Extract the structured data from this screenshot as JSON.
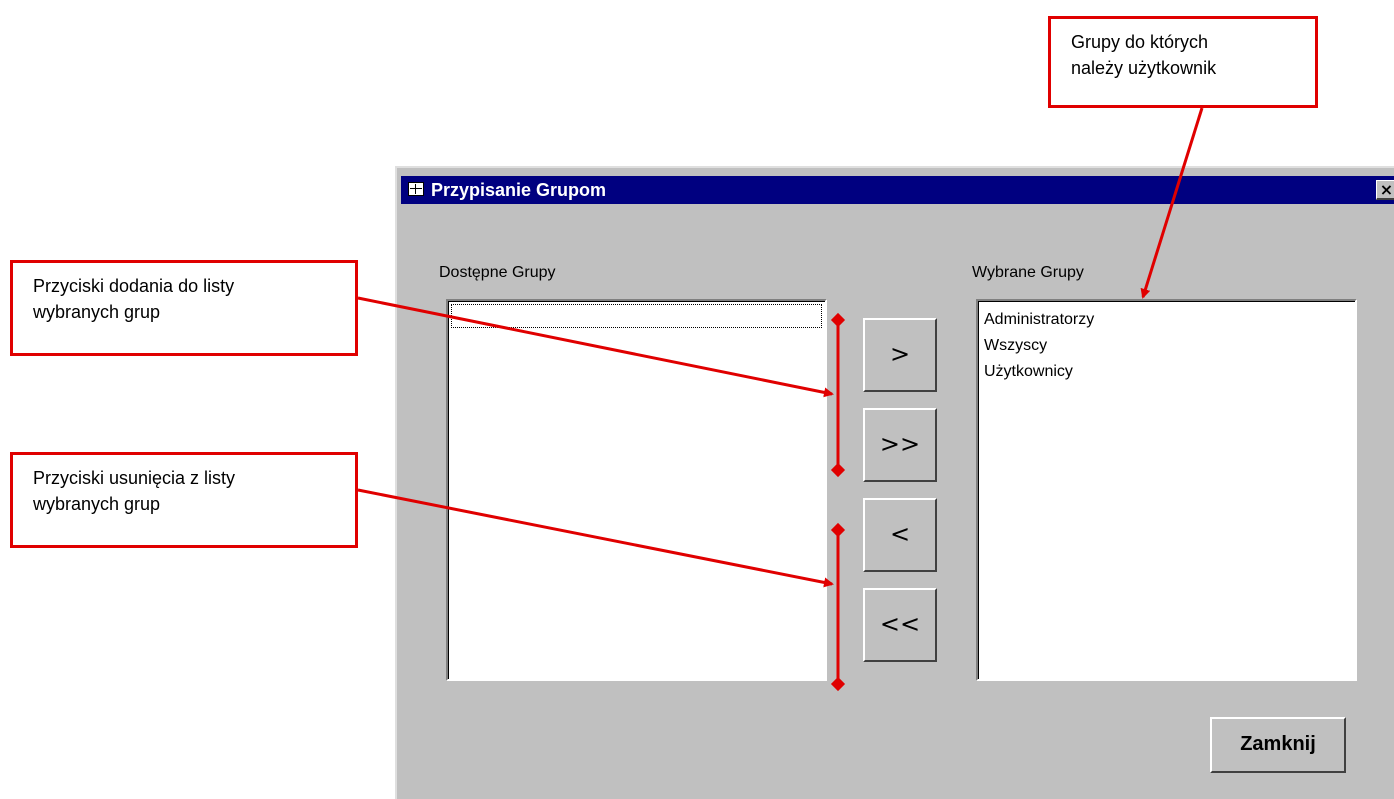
{
  "window": {
    "title": "Przypisanie Grupom",
    "close_glyph": "×"
  },
  "available": {
    "label": "Dostępne Grupy",
    "items": []
  },
  "selected": {
    "label": "Wybrane Grupy",
    "items": [
      "Administratorzy",
      "Wszyscy",
      "Użytkownicy"
    ]
  },
  "buttons": {
    "add_one": ">",
    "add_all": ">>",
    "remove_one": "<",
    "remove_all": "<<",
    "close": "Zamknij"
  },
  "annotations": {
    "groups_of_user": [
      "Grupy do których",
      "należy użytkownik"
    ],
    "add_buttons": [
      "Przyciski dodania do listy",
      "wybranych grup"
    ],
    "remove_buttons": [
      "Przyciski usunięcia z listy",
      "wybranych grup"
    ],
    "accent_color": "#e00000"
  },
  "colors": {
    "titlebar": "#000080",
    "dialog_bg": "#c0c0c0"
  }
}
